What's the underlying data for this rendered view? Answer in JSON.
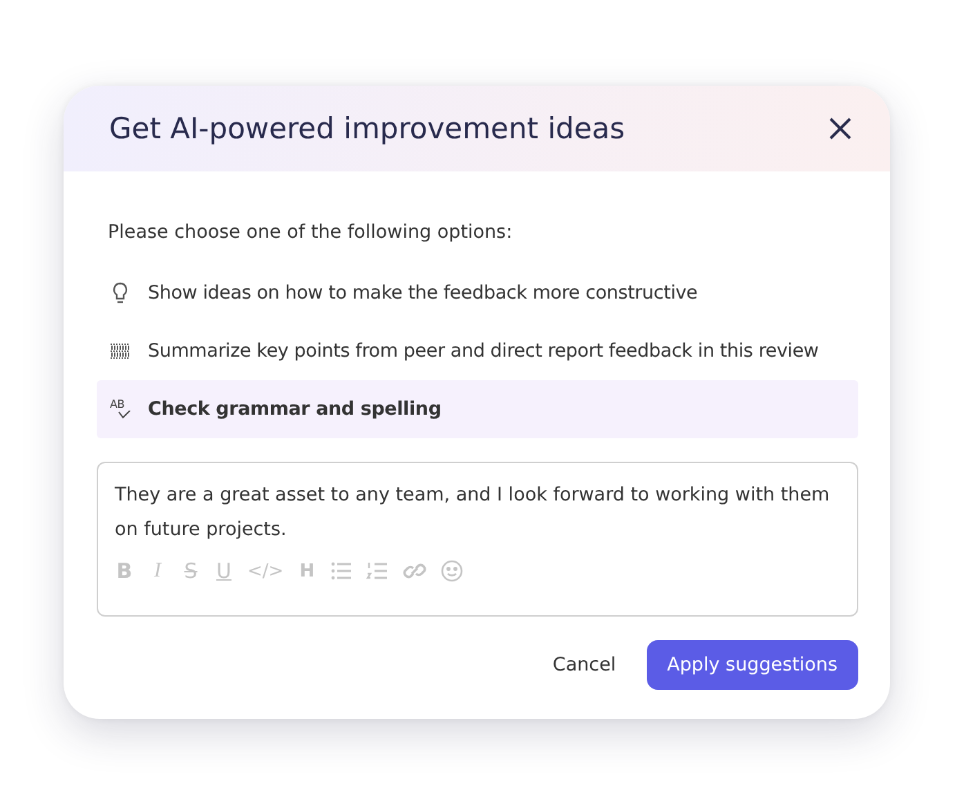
{
  "dialog": {
    "title": "Get AI-powered improvement ideas",
    "prompt": "Please choose one of the following options:",
    "options": [
      {
        "kind": "bulb",
        "label": "Show ideas on how to make the feedback more constructive",
        "selected": false
      },
      {
        "kind": "summary",
        "label": "Summarize key points from peer and direct report feedback in this review",
        "selected": false
      },
      {
        "kind": "grammar",
        "icon_text": "AB",
        "label": "Check grammar and spelling",
        "selected": true
      }
    ],
    "editor": {
      "value": "They are a great asset to any team, and I look forward to working with them on future projects.",
      "toolbar": [
        {
          "kind": "bold",
          "label": "B"
        },
        {
          "kind": "italic",
          "label": "I"
        },
        {
          "kind": "strike",
          "label": "S"
        },
        {
          "kind": "underline",
          "label": "U"
        },
        {
          "kind": "code",
          "label": "</>"
        },
        {
          "kind": "heading",
          "label": "H"
        },
        {
          "kind": "bullets"
        },
        {
          "kind": "numbers"
        },
        {
          "kind": "link"
        },
        {
          "kind": "emoji"
        }
      ]
    },
    "buttons": [
      {
        "kind": "secondary",
        "label": "Cancel"
      },
      {
        "kind": "primary",
        "label": "Apply suggestions"
      }
    ]
  }
}
